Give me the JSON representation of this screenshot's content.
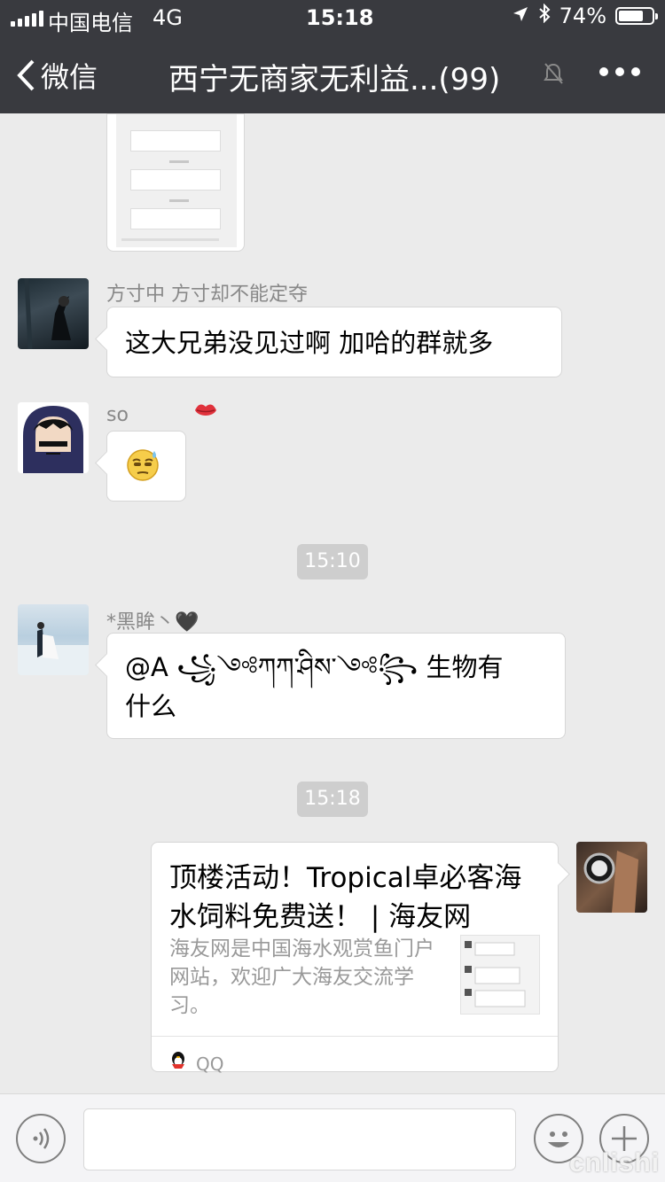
{
  "status": {
    "carrier": "中国电信",
    "network": "4G",
    "time": "15:18",
    "battery": "74%",
    "battery_level": 0.74
  },
  "nav": {
    "back_label": "微信",
    "title": "西宁无商家无利益...(99)"
  },
  "messages": [
    {
      "sender": "方寸中 方寸却不能定夺",
      "text": "这大兄弟没见过啊  加哈的群就多"
    },
    {
      "sender": "so",
      "emoji": "😓"
    },
    {
      "time": "15:10"
    },
    {
      "sender": "*黑眸丶🖤",
      "text_line1": "@A ꧁༺ཀཀ་ཤིས་༺꧂ 生物有",
      "text_line2": "什么"
    },
    {
      "time": "15:18"
    }
  ],
  "card": {
    "title": "顶楼活动！Tropical卓必客海水饲料免费送！ | 海友网",
    "description": "海友网是中国海水观赏鱼门户网站，欢迎广大海友交流学习。",
    "source": "QQ"
  },
  "watermark": "cnlishi"
}
